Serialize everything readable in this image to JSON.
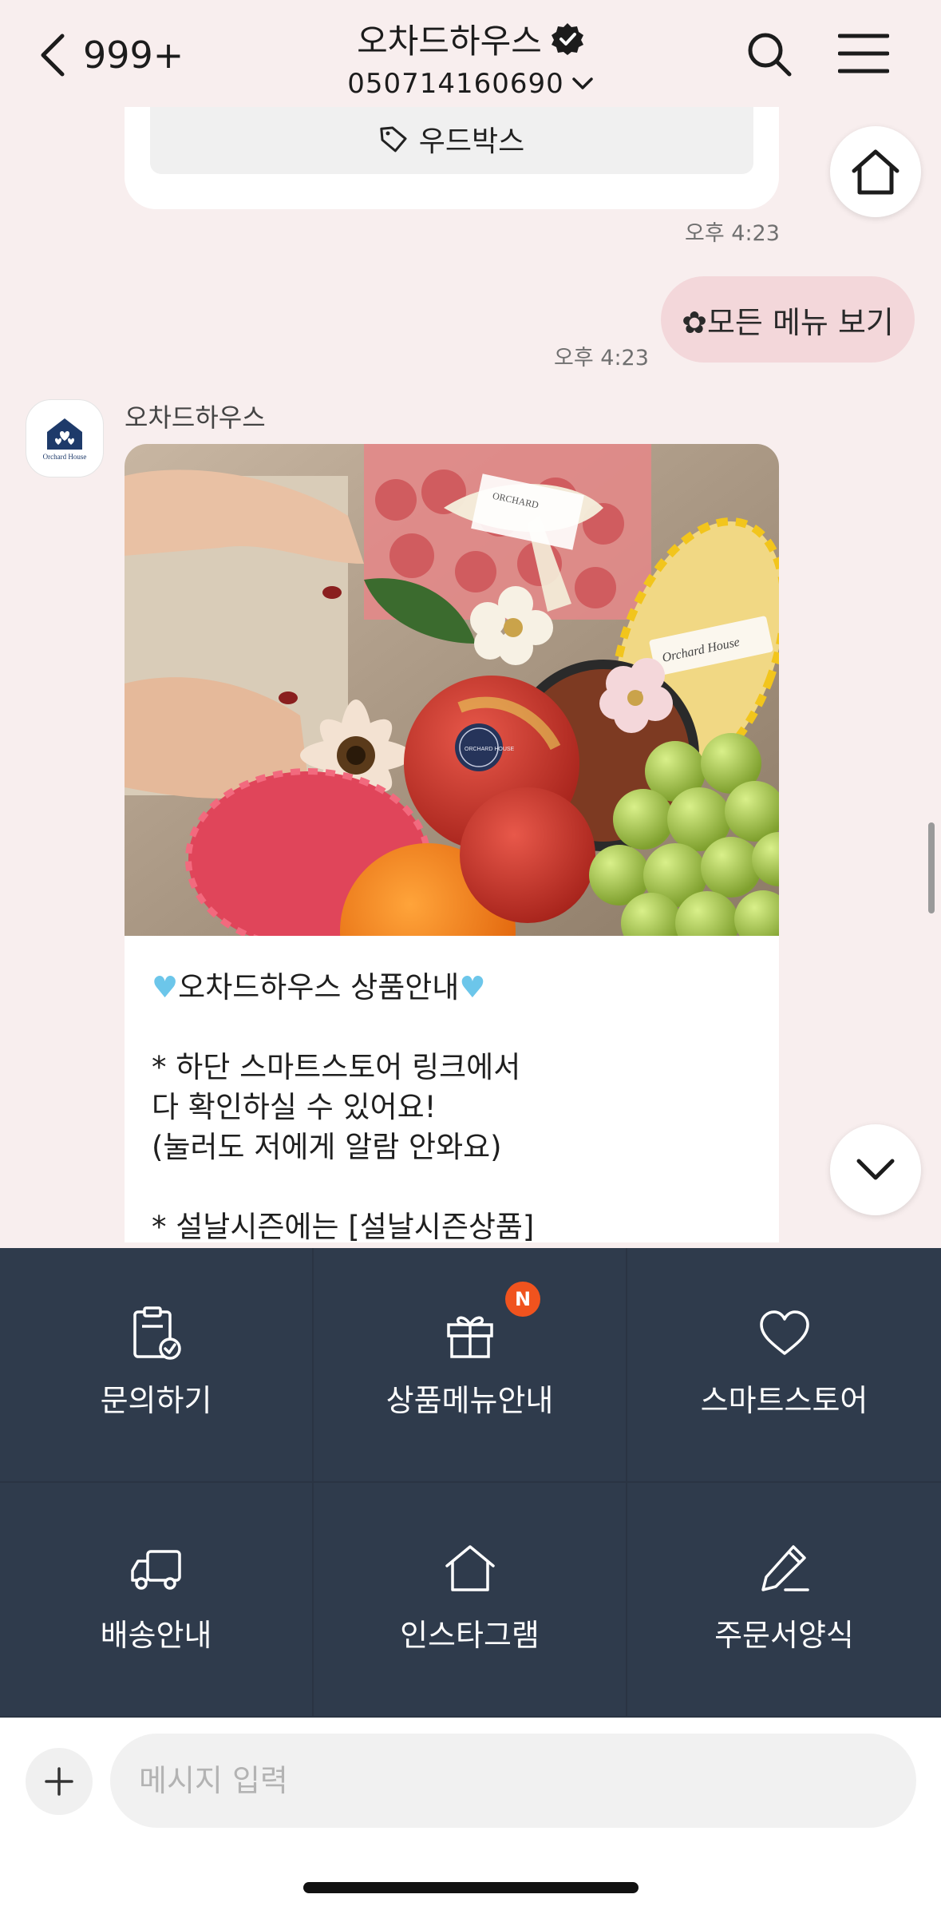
{
  "header": {
    "back_count": "999+",
    "title": "오차드하우스",
    "phone": "050714160690"
  },
  "chat": {
    "woodbox_label": "우드박스",
    "time1": "오후 4:23",
    "my_message": "✿모든 메뉴 보기",
    "time2": "오후 4:23",
    "sender_name": "오차드하우스",
    "avatar_text": "Orchard House",
    "photo_labels": {
      "ribbon_card": "ORCHARD",
      "pear_tag": "Orchard House",
      "apple_sticker": "ORCHARD HOUSE"
    },
    "message_title": "오차드하우스 상품안내",
    "message_body": "* 하단 스마트스토어 링크에서\n다 확인하실 수 있어요!\n(눌러도 저에게 알람 안와요)\n\n* 설날시즌에는 [설날시즌상품]"
  },
  "menu": {
    "items": [
      {
        "label": "문의하기",
        "icon": "clipboard-check-icon"
      },
      {
        "label": "상품메뉴안내",
        "icon": "gift-icon",
        "badge": "N"
      },
      {
        "label": "스마트스토어",
        "icon": "heart-icon"
      },
      {
        "label": "배송안내",
        "icon": "truck-icon"
      },
      {
        "label": "인스타그램",
        "icon": "home-icon"
      },
      {
        "label": "주문서양식",
        "icon": "pencil-icon"
      }
    ]
  },
  "input": {
    "placeholder": "메시지 입력"
  },
  "colors": {
    "background": "#f8eeee",
    "my_bubble": "#f3d7da",
    "menu_bg": "#2f3b4c",
    "badge": "#f0531e",
    "heart": "#6cc6ea"
  }
}
